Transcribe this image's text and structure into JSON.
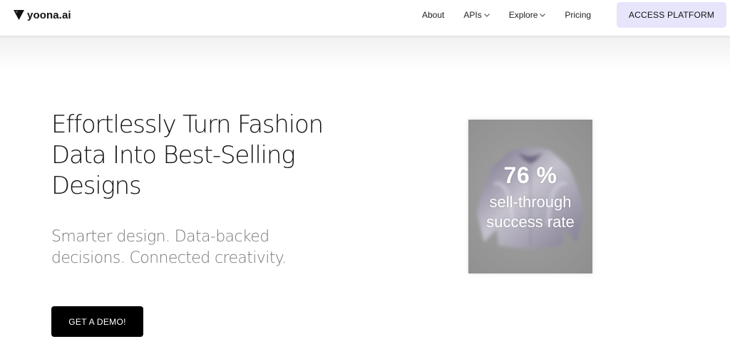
{
  "brand": {
    "name": "yoona.ai",
    "logo_icon": "triangle-logo-icon"
  },
  "nav": {
    "items": [
      {
        "label": "About",
        "has_dropdown": false
      },
      {
        "label": "APIs",
        "has_dropdown": true
      },
      {
        "label": "Explore",
        "has_dropdown": true
      },
      {
        "label": "Pricing",
        "has_dropdown": false
      }
    ],
    "cta_label": "ACCESS PLATFORM"
  },
  "hero": {
    "title_lines": [
      "Effortlessly Turn Fashion",
      "Data Into Best-Selling",
      "Designs"
    ],
    "subtitle_lines": [
      "Smarter design. Data-backed",
      "decisions. Connected creativity."
    ],
    "cta_label": "GET A DEMO!"
  },
  "promo": {
    "percent": "76 %",
    "line1": "sell-through",
    "line2": "success rate"
  },
  "colors": {
    "cta_primary_bg": "#000000",
    "cta_secondary_bg": "#e6e5fb",
    "subtitle_text": "#777777"
  }
}
